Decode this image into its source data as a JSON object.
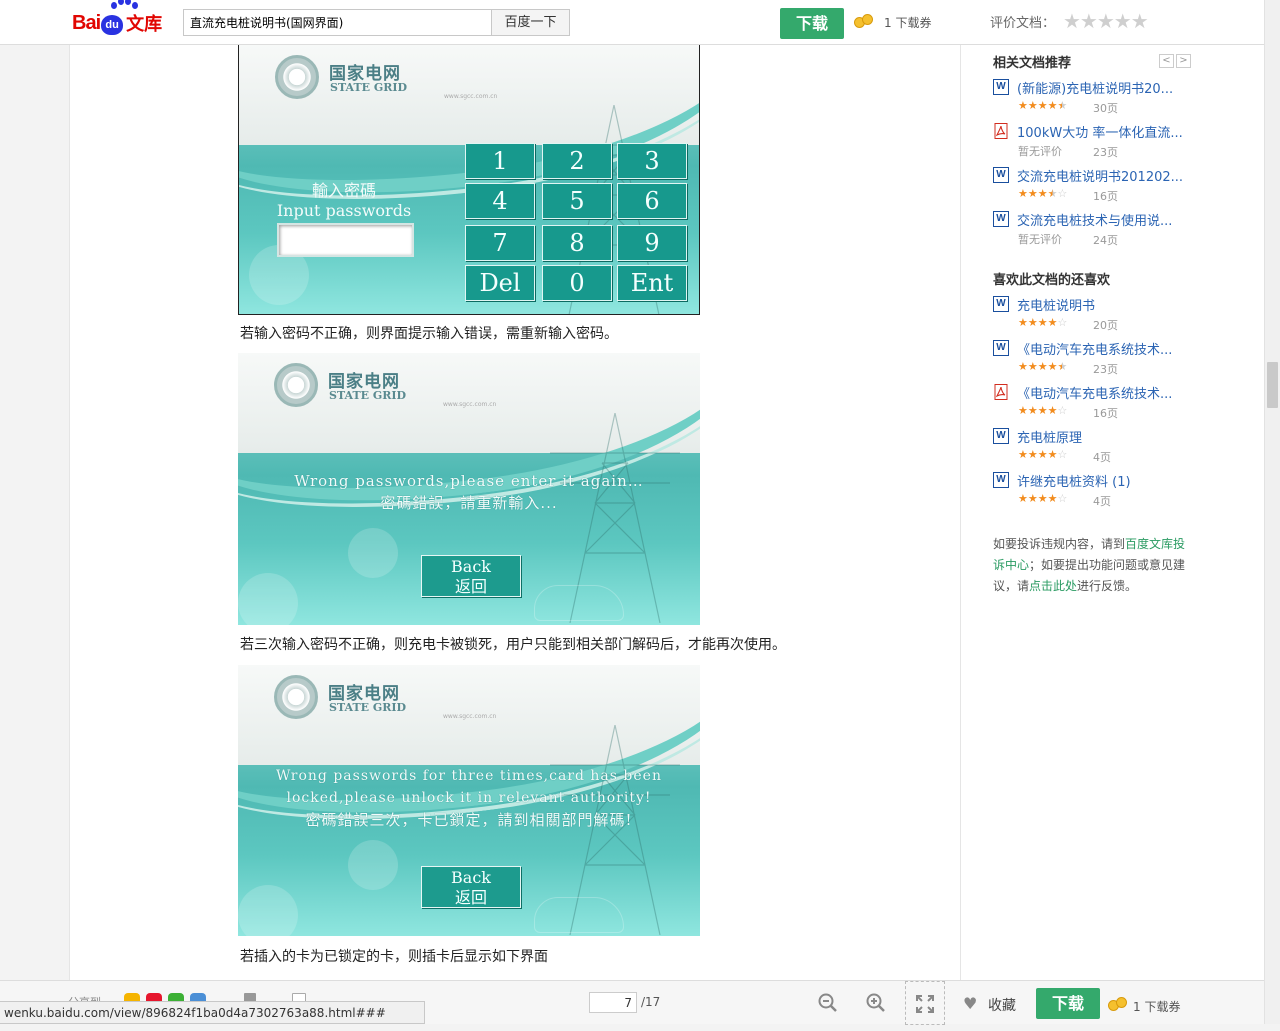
{
  "header": {
    "logo_bai": "Bai",
    "logo_du": "du",
    "logo_wenku": "文库",
    "search_value": "直流充电桩说明书(国网界面)",
    "search_button": "百度一下",
    "download_label": "下载",
    "download_ticket": "1 下载券",
    "rating_label": "评价文档：",
    "rating_stars": "★★★★★"
  },
  "document": {
    "screen_brand_cn": "国家电网",
    "screen_brand_en": "STATE GRID",
    "screen_url": "www.sgcc.com.cn",
    "screen1": {
      "label_cn": "輸入密碼",
      "label_en": "Input passwords",
      "keys": [
        "1",
        "2",
        "3",
        "4",
        "5",
        "6",
        "7",
        "8",
        "9",
        "Del",
        "0",
        "Ent"
      ]
    },
    "caption1": "若输入密码不正确，则界面提示输入错误，需重新输入密码。",
    "screen2": {
      "message_en": "Wrong passwords,please enter it again…",
      "message_cn": "密碼錯誤，請重新輸入...",
      "back_en": "Back",
      "back_cn": "返回"
    },
    "caption2": "若三次输入密码不正确，则充电卡被锁死，用户只能到相关部门解码后，才能再次使用。",
    "screen3": {
      "message_en_1": "Wrong passwords for three times,card has been",
      "message_en_2": "locked,please unlock it in relevant authority!",
      "message_cn": "密碼錯誤三次，卡已鎖定，請到相關部門解碼!",
      "back_en": "Back",
      "back_cn": "返回"
    },
    "caption3": "若插入的卡为已锁定的卡，则插卡后显示如下界面"
  },
  "sidebar": {
    "related_title": "相关文档推荐",
    "pager_prev": "<",
    "pager_next": ">",
    "related": [
      {
        "icon": "word-icon",
        "glyph": "W",
        "name": "(新能源)充电桩说明书20...",
        "rating": 4.5,
        "stars_on": "★★★★",
        "stars_half": "★",
        "stars_off": "",
        "pages": "30页"
      },
      {
        "icon": "pdf-icon",
        "glyph": "",
        "name": "100kW大功 率一体化直流...",
        "no_rating": "暂无评价",
        "pages": "23页"
      },
      {
        "icon": "word-icon",
        "glyph": "W",
        "name": "交流充电桩说明书201202...",
        "rating": 3.5,
        "stars_on": "★★★",
        "stars_half": "★",
        "stars_off": "☆",
        "pages": "16页"
      },
      {
        "icon": "word-icon",
        "glyph": "W",
        "name": "交流充电桩技术与使用说...",
        "no_rating": "暂无评价",
        "pages": "24页"
      }
    ],
    "liked_title": "喜欢此文档的还喜欢",
    "liked": [
      {
        "icon": "word-icon",
        "glyph": "W",
        "name": "充电桩说明书",
        "rating": 4,
        "stars_on": "★★★★",
        "stars_off": "☆",
        "pages": "20页"
      },
      {
        "icon": "word-icon",
        "glyph": "W",
        "name": "《电动汽车充电系统技术...",
        "rating": 4.5,
        "stars_on": "★★★★",
        "stars_half": "★",
        "stars_off": "",
        "pages": "23页"
      },
      {
        "icon": "pdf-icon",
        "glyph": "",
        "name": "《电动汽车充电系统技术...",
        "rating": 4,
        "stars_on": "★★★★",
        "stars_off": "☆",
        "pages": "16页"
      },
      {
        "icon": "word-icon",
        "glyph": "W",
        "name": "充电桩原理",
        "rating": 4,
        "stars_on": "★★★★",
        "stars_off": "☆",
        "pages": "4页"
      },
      {
        "icon": "word-icon",
        "glyph": "W",
        "name": "许继充电桩资料 (1)",
        "rating": 4,
        "stars_on": "★★★★",
        "stars_off": "☆",
        "pages": "4页"
      }
    ],
    "report_pre": "如要投诉违规内容，请到",
    "report_link1": "百度文库投诉中心",
    "report_mid": "；如要提出功能问题或意见建议，请",
    "report_link2": "点击此处",
    "report_post": "进行反馈。"
  },
  "bottom": {
    "share_label": "分享到",
    "page_current": "7",
    "page_total": "/17",
    "favorite": "收藏",
    "download_label": "下载",
    "download_ticket": "1 下载券"
  },
  "statusbar": {
    "url": "wenku.baidu.com/view/896824f1ba0d4a7302763a88.html###"
  },
  "colors": {
    "accent_green": "#34a96c",
    "link_blue": "#2b64b3",
    "star_orange": "#f28c1e",
    "screen_teal": "#17998d"
  }
}
